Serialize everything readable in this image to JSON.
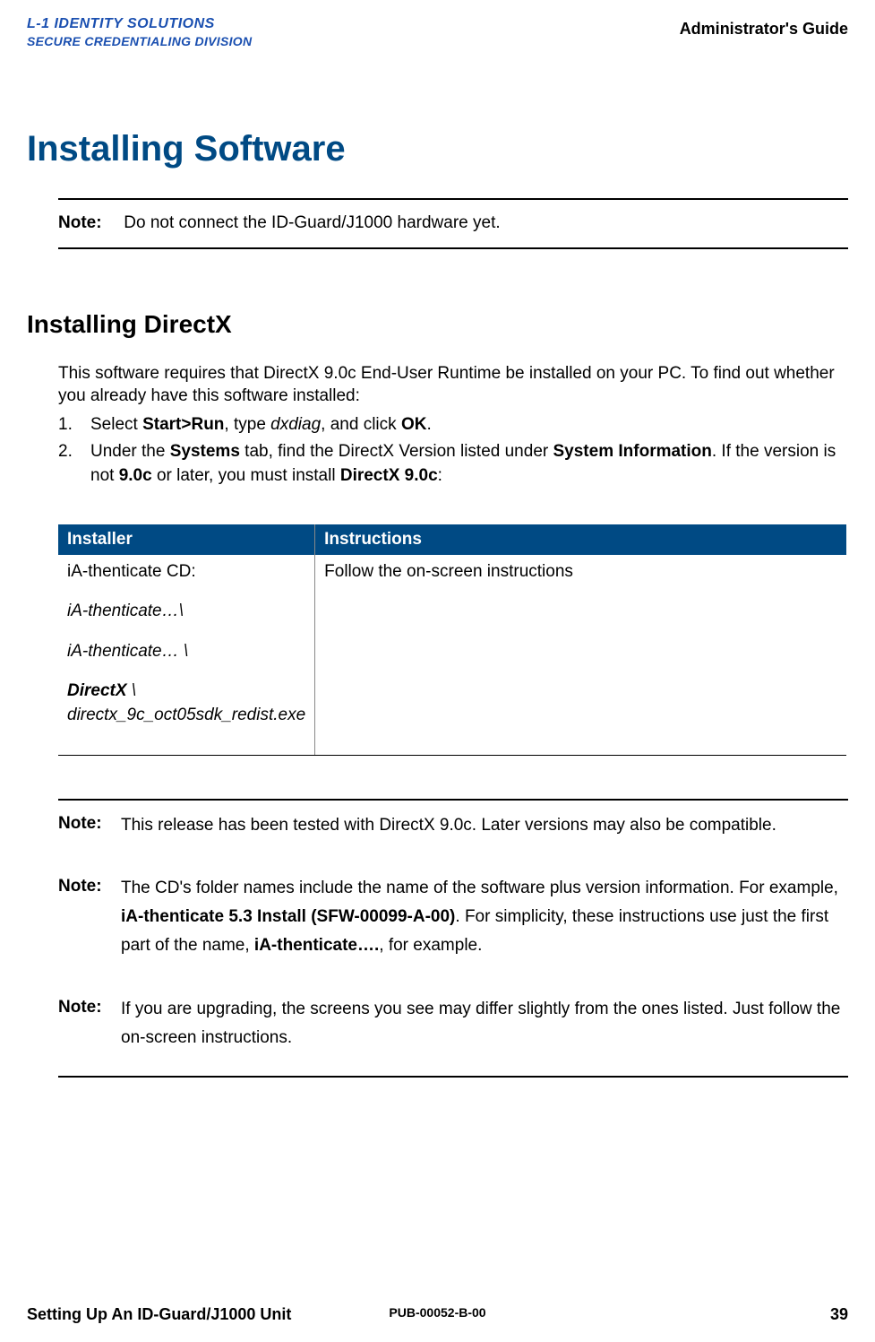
{
  "header": {
    "logo_line1": "L-1 IDENTITY SOLUTIONS",
    "logo_line2": "SECURE CREDENTIALING DIVISION",
    "guide_title": "Administrator's Guide"
  },
  "chapter_title": "Installing Software",
  "note1": {
    "label": "Note:",
    "text": "Do not connect the ID-Guard/J1000 hardware yet."
  },
  "section_title": "Installing DirectX",
  "intro_para": "This software requires that DirectX 9.0c End-User Runtime be installed on your PC. To find out whether you already have this software installed:",
  "steps": {
    "s1": {
      "num": "1.",
      "pre": "Select ",
      "b1": "Start>Run",
      "mid": ", type ",
      "i1": "dxdiag",
      "post": ", and click ",
      "b2": "OK",
      "end": "."
    },
    "s2": {
      "num": "2.",
      "pre": "Under the ",
      "b1": "Systems",
      "mid1": " tab, find the DirectX Version listed under ",
      "b2": "System Information",
      "mid2": ". If the version is not ",
      "b3": "9.0c",
      "mid3": " or later, you must install ",
      "b4": "DirectX 9.0c",
      "end": ":"
    }
  },
  "table": {
    "h1": "Installer",
    "h2": "Instructions",
    "r1c1_a": "iA-thenticate CD:",
    "r1c1_b": "iA-thenticate…\\",
    "r1c1_c": "iA-thenticate… \\",
    "r1c1_d_bold": "DirectX",
    "r1c1_d_rest": " \\",
    "r1c1_e": "directx_9c_oct05sdk_redist.exe",
    "r1c2": "Follow the on-screen instructions"
  },
  "notes": {
    "n2": {
      "label": "Note:",
      "text": "This release has been tested with DirectX 9.0c. Later versions may also be compatible."
    },
    "n3": {
      "label": "Note:",
      "pre": "The CD's folder names include the name of the software plus version information. For example, ",
      "b1": "iA-thenticate 5.3 Install (SFW-00099-A-00)",
      "mid": ". For simplicity, these instructions use just the first part of the name, ",
      "b2": "iA-thenticate….",
      "post": ", for example."
    },
    "n4": {
      "label": "Note:",
      "text": "If you are upgrading, the screens you see may differ slightly from the ones listed. Just follow the on-screen instructions."
    }
  },
  "footer": {
    "left": "Setting Up An ID-Guard/J1000 Unit",
    "center": "PUB-00052-B-00",
    "right": "39"
  }
}
